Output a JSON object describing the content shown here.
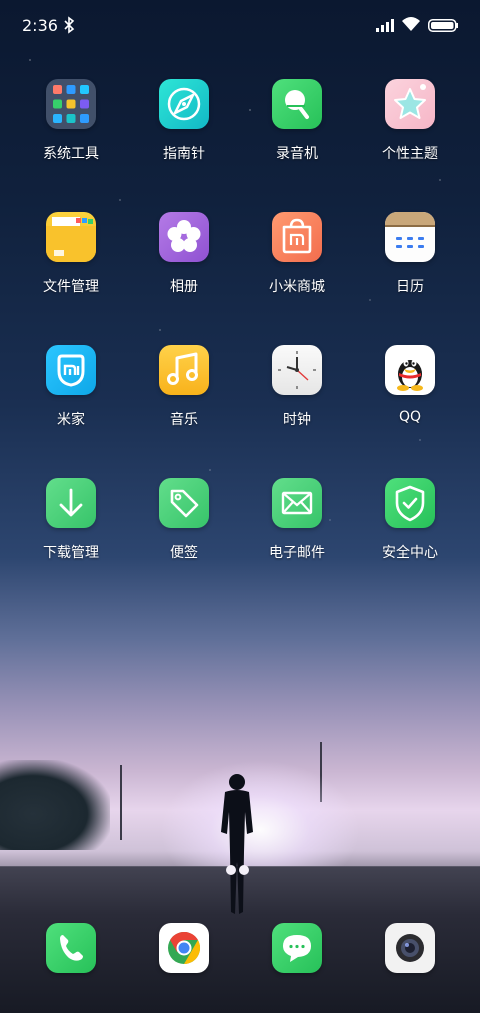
{
  "status_bar": {
    "time": "2:36",
    "icons": [
      "bluetooth-icon",
      "signal-icon",
      "wifi-icon",
      "battery-icon"
    ]
  },
  "apps": [
    {
      "label": "系统工具",
      "icon": "system-tools-folder-icon"
    },
    {
      "label": "指南针",
      "icon": "compass-icon"
    },
    {
      "label": "录音机",
      "icon": "recorder-icon"
    },
    {
      "label": "个性主题",
      "icon": "themes-icon"
    },
    {
      "label": "文件管理",
      "icon": "file-manager-icon"
    },
    {
      "label": "相册",
      "icon": "gallery-icon"
    },
    {
      "label": "小米商城",
      "icon": "mi-store-icon"
    },
    {
      "label": "日历",
      "icon": "calendar-icon"
    },
    {
      "label": "米家",
      "icon": "mi-home-icon"
    },
    {
      "label": "音乐",
      "icon": "music-icon"
    },
    {
      "label": "时钟",
      "icon": "clock-icon"
    },
    {
      "label": "QQ",
      "icon": "qq-icon"
    },
    {
      "label": "下载管理",
      "icon": "downloads-icon"
    },
    {
      "label": "便签",
      "icon": "notes-icon"
    },
    {
      "label": "电子邮件",
      "icon": "email-icon"
    },
    {
      "label": "安全中心",
      "icon": "security-icon"
    }
  ],
  "dock": [
    {
      "icon": "phone-icon"
    },
    {
      "icon": "chrome-icon"
    },
    {
      "icon": "messages-icon"
    },
    {
      "icon": "camera-icon"
    }
  ],
  "colors": {
    "green": "#3ed46a",
    "teal": "#22d0c8",
    "yellow": "#f7c531",
    "purple": "#a45fd6",
    "coral": "#f77b5c",
    "blue": "#1ab6f0"
  }
}
